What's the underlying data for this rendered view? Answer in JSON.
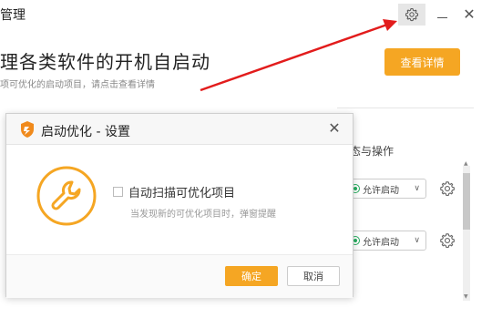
{
  "window": {
    "title": "管理"
  },
  "header": {
    "headline": "理各类软件的开机自启动",
    "subline": "项可优化的启动项目，请点击查看详情",
    "detail_button": "查看详情"
  },
  "list": {
    "column_header": "态与操作",
    "rows": [
      {
        "status": "允许启动"
      },
      {
        "status": "允许启动"
      }
    ]
  },
  "dialog": {
    "title": "启动优化 - 设置",
    "checkbox_label": "自动扫描可优化项目",
    "checkbox_hint": "当发现新的可优化项目时，弹窗提醒",
    "checkbox_checked": false,
    "ok_label": "确定",
    "cancel_label": "取消"
  },
  "colors": {
    "accent": "#f5a623",
    "arrow": "#e21c1c",
    "status_green": "#27ae60"
  },
  "icons": {
    "settings": "gear-icon",
    "minimize": "minimize-icon",
    "close": "close-icon",
    "dialog_logo": "shield-logo-icon",
    "dialog_body": "wrench-icon"
  }
}
